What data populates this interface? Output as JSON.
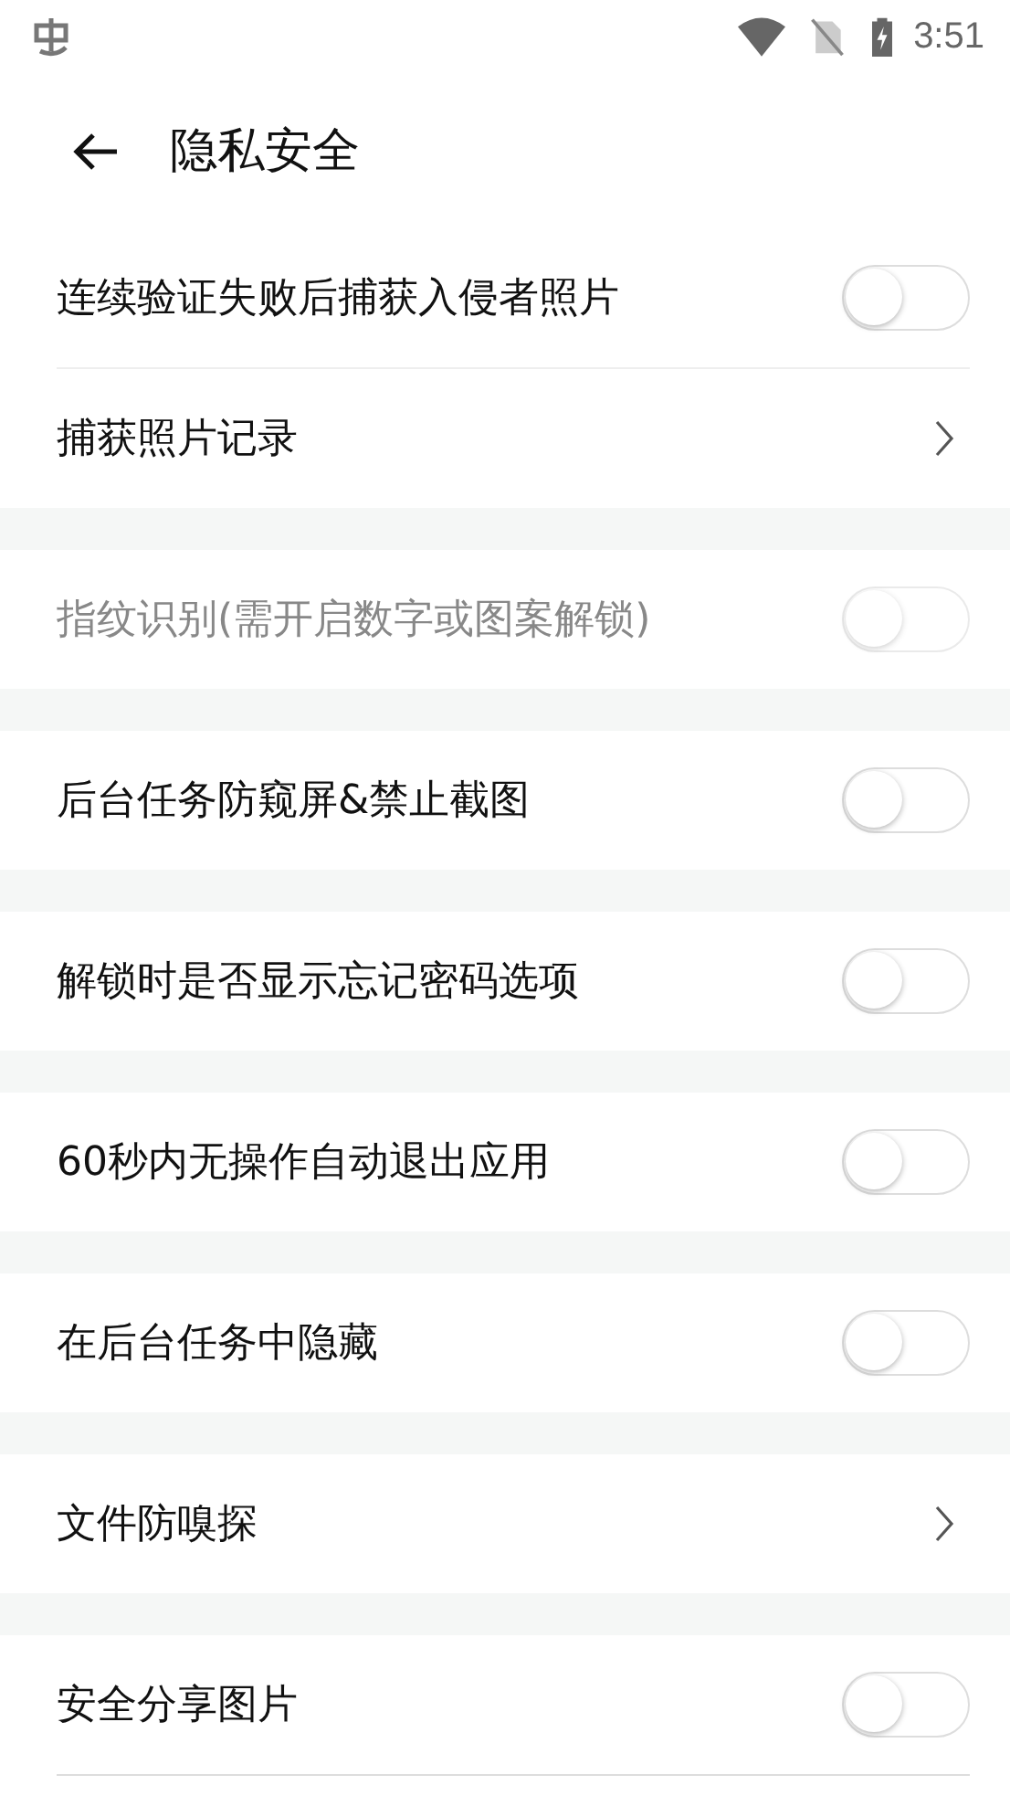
{
  "status_bar": {
    "time": "3:51"
  },
  "header": {
    "title": "隐私安全"
  },
  "groups": [
    {
      "items": [
        {
          "kind": "toggle",
          "label": "连续验证失败后捕获入侵者照片",
          "on": false,
          "disabled": false
        },
        {
          "kind": "link",
          "label": "捕获照片记录"
        }
      ]
    },
    {
      "items": [
        {
          "kind": "toggle",
          "label": "指纹识别(需开启数字或图案解锁)",
          "on": false,
          "disabled": true
        }
      ]
    },
    {
      "items": [
        {
          "kind": "toggle",
          "label": "后台任务防窥屏&禁止截图",
          "on": false,
          "disabled": false
        }
      ]
    },
    {
      "items": [
        {
          "kind": "toggle",
          "label": "解锁时是否显示忘记密码选项",
          "on": false,
          "disabled": false
        }
      ]
    },
    {
      "items": [
        {
          "kind": "toggle",
          "label": "60秒内无操作自动退出应用",
          "on": false,
          "disabled": false
        }
      ]
    },
    {
      "items": [
        {
          "kind": "toggle",
          "label": "在后台任务中隐藏",
          "on": false,
          "disabled": false
        }
      ]
    },
    {
      "items": [
        {
          "kind": "link",
          "label": "文件防嗅探"
        }
      ]
    },
    {
      "items": [
        {
          "kind": "toggle",
          "label": "安全分享图片",
          "on": false,
          "disabled": false
        }
      ],
      "bottom_divider": true
    }
  ]
}
